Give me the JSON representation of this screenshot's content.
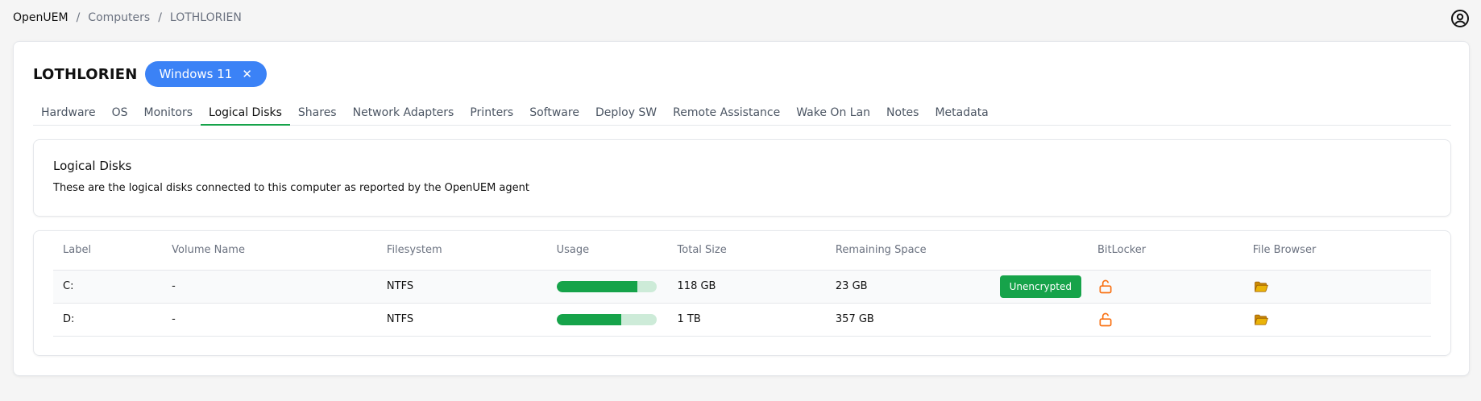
{
  "breadcrumb": {
    "home": "OpenUEM",
    "separator": "/",
    "section": "Computers",
    "current": "LOTHLORIEN"
  },
  "header": {
    "computer_name": "LOTHLORIEN",
    "os_badge": "Windows 11",
    "os_badge_close": "✕"
  },
  "tabs": [
    {
      "label": "Hardware",
      "active": false
    },
    {
      "label": "OS",
      "active": false
    },
    {
      "label": "Monitors",
      "active": false
    },
    {
      "label": "Logical Disks",
      "active": true
    },
    {
      "label": "Shares",
      "active": false
    },
    {
      "label": "Network Adapters",
      "active": false
    },
    {
      "label": "Printers",
      "active": false
    },
    {
      "label": "Software",
      "active": false
    },
    {
      "label": "Deploy SW",
      "active": false
    },
    {
      "label": "Remote Assistance",
      "active": false
    },
    {
      "label": "Wake On Lan",
      "active": false
    },
    {
      "label": "Notes",
      "active": false
    },
    {
      "label": "Metadata",
      "active": false
    }
  ],
  "info": {
    "title": "Logical Disks",
    "description": "These are the logical disks connected to this computer as reported by the OpenUEM agent"
  },
  "table": {
    "columns": [
      "Label",
      "Volume Name",
      "Filesystem",
      "Usage",
      "Total Size",
      "Remaining Space",
      "",
      "BitLocker",
      "File Browser"
    ],
    "rows": [
      {
        "label": "C:",
        "volume": "-",
        "filesystem": "NTFS",
        "usage_fraction": 0.81,
        "total": "118 GB",
        "remaining": "23 GB",
        "encryption": "Unencrypted"
      },
      {
        "label": "D:",
        "volume": "-",
        "filesystem": "NTFS",
        "usage_fraction": 0.65,
        "total": "1 TB",
        "remaining": "357 GB",
        "encryption": ""
      }
    ]
  },
  "colors": {
    "accent_green": "#16a34a",
    "badge_blue": "#3b82f6",
    "lock_orange": "#f97316",
    "folder_yellow": "#eab308"
  },
  "icons": {
    "user": "user-circle-icon",
    "bitlocker": "lock-open-icon",
    "file_browser": "folder-open-icon"
  }
}
